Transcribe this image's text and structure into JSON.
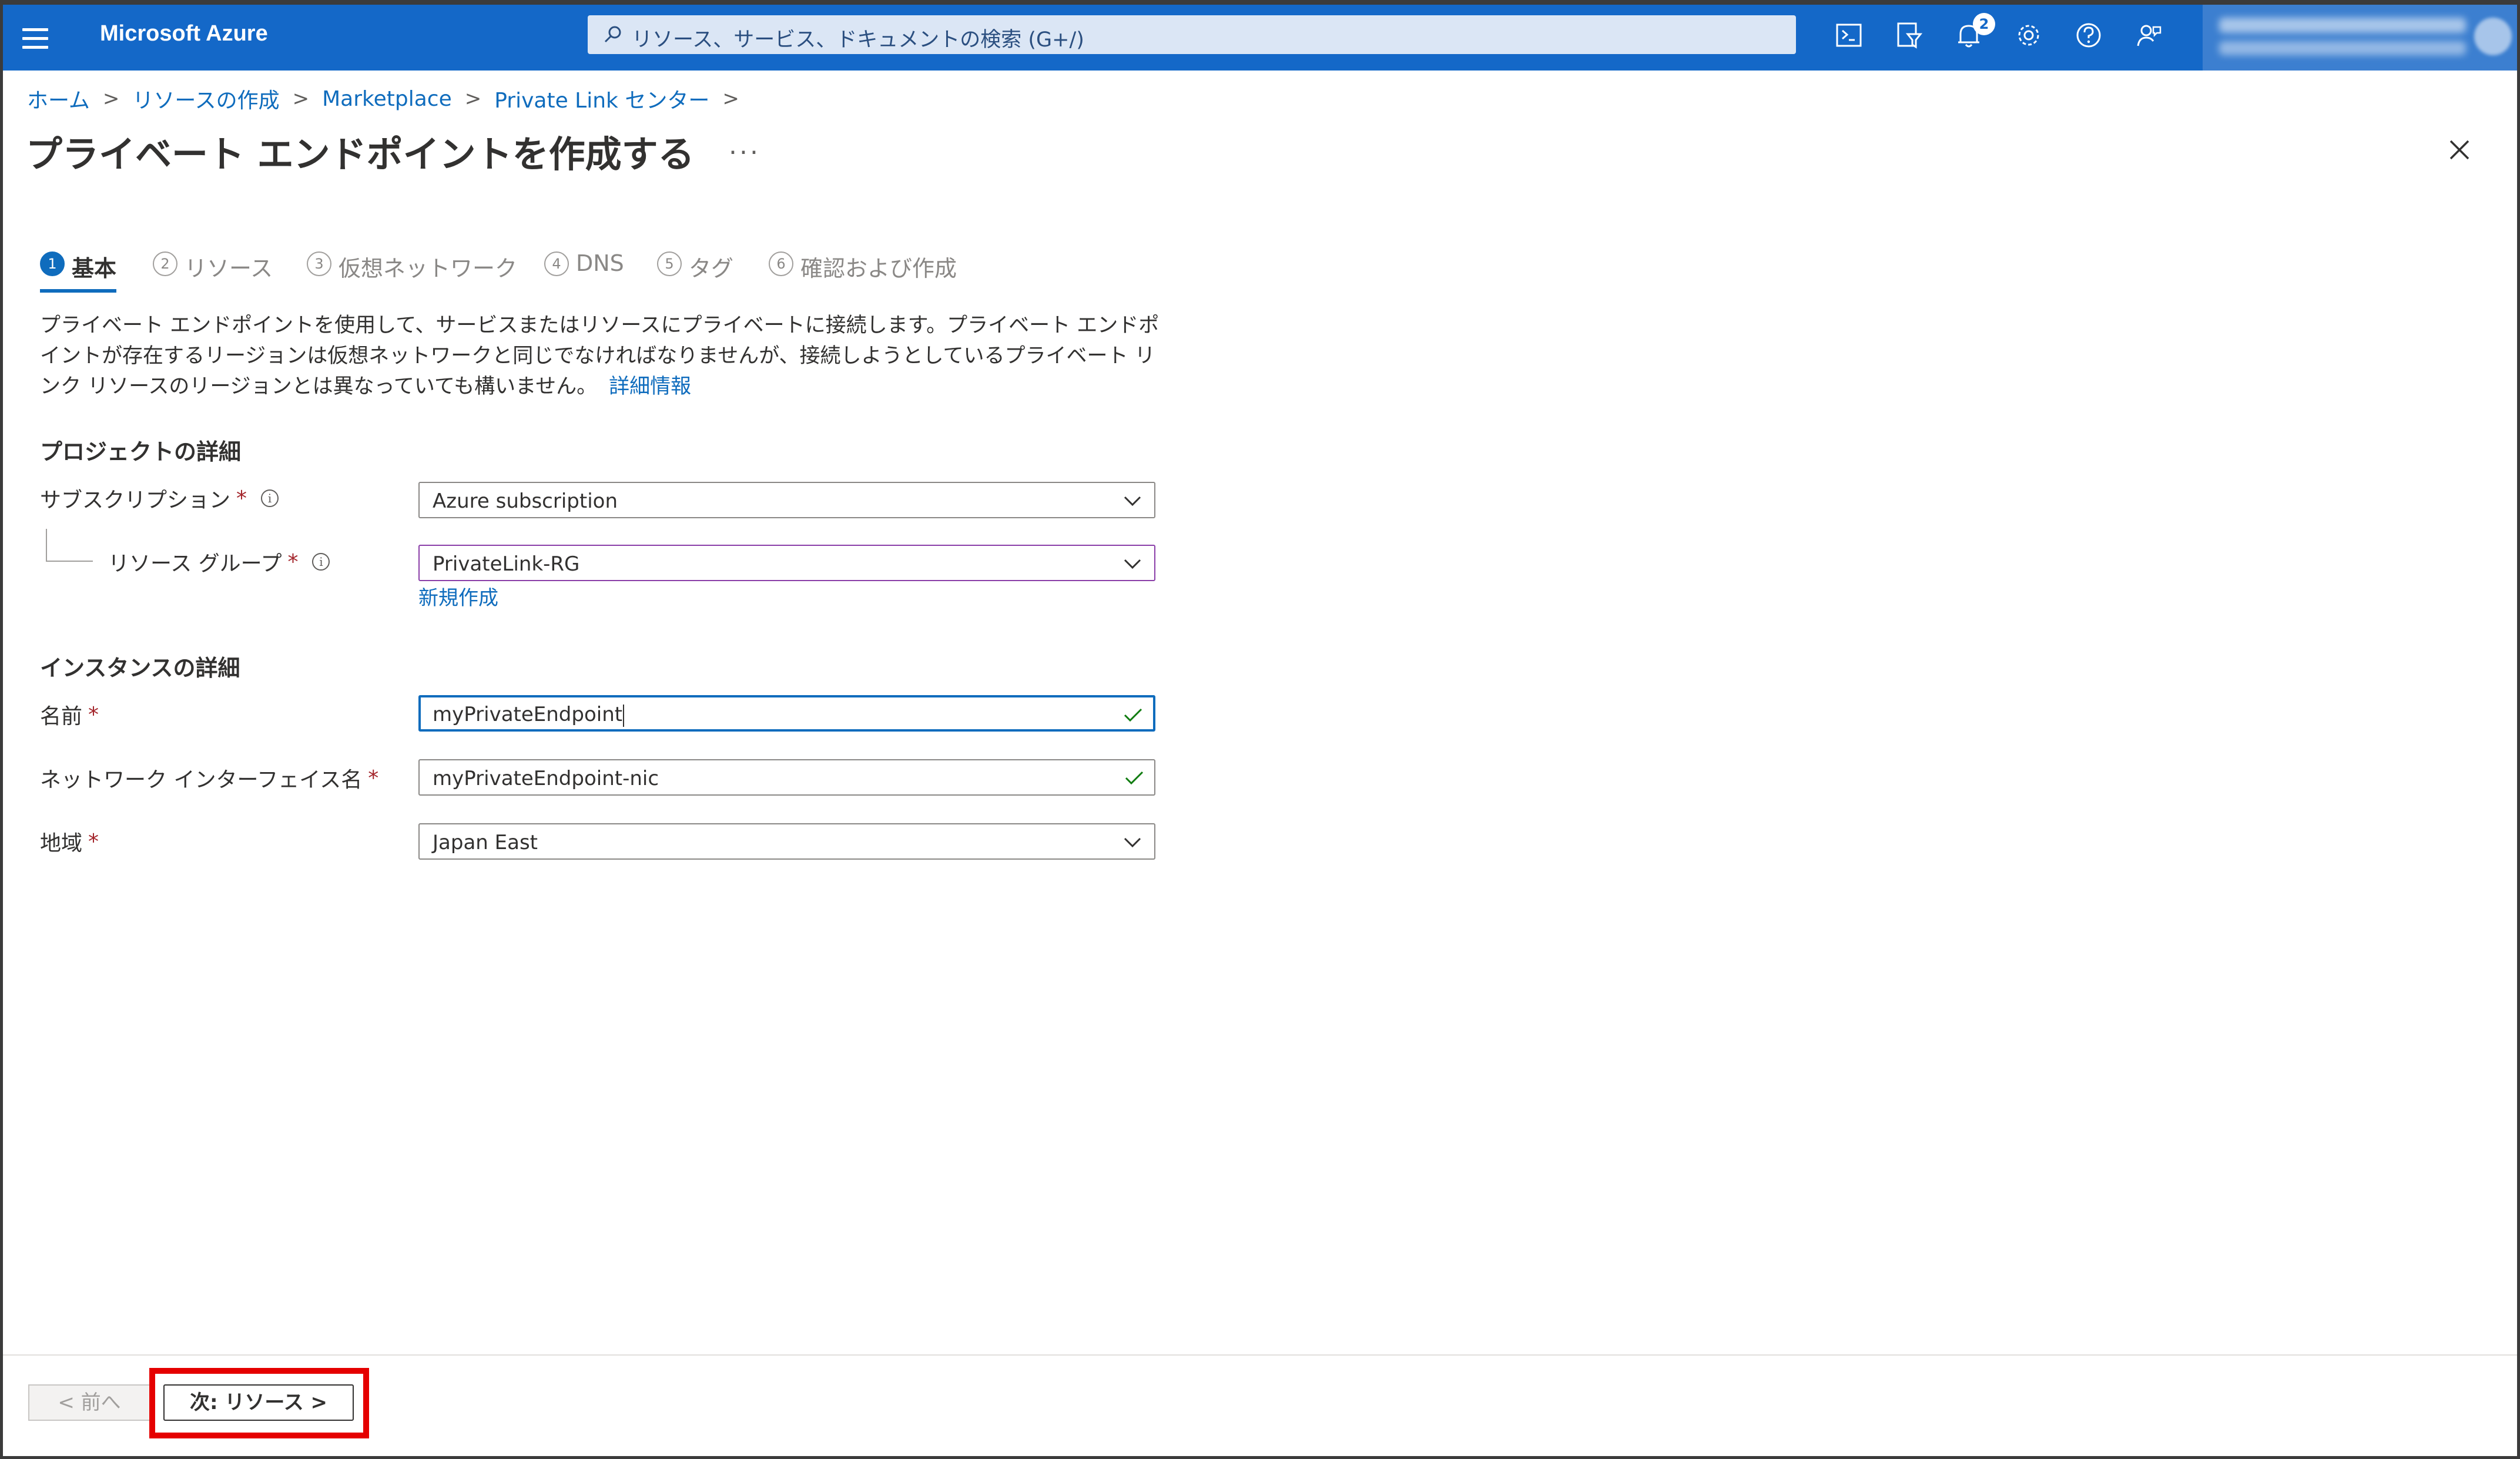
{
  "header": {
    "brand": "Microsoft Azure",
    "search_placeholder": "リソース、サービス、ドキュメントの検索 (G+/)",
    "notification_count": "2",
    "icons": [
      "menu-icon",
      "cloud-shell-icon",
      "directory-filter-icon",
      "notifications-icon",
      "settings-icon",
      "help-icon",
      "feedback-icon"
    ]
  },
  "breadcrumb": [
    "ホーム",
    "リソースの作成",
    "Marketplace",
    "Private Link センター"
  ],
  "page": {
    "title": "プライベート エンドポイントを作成する",
    "more": "..."
  },
  "tabs": [
    {
      "num": "1",
      "label": "基本",
      "active": true
    },
    {
      "num": "2",
      "label": "リソース",
      "active": false
    },
    {
      "num": "3",
      "label": "仮想ネットワーク",
      "active": false
    },
    {
      "num": "4",
      "label": "DNS",
      "active": false
    },
    {
      "num": "5",
      "label": "タグ",
      "active": false
    },
    {
      "num": "6",
      "label": "確認および作成",
      "active": false
    }
  ],
  "description": {
    "text": "プライベート エンドポイントを使用して、サービスまたはリソースにプライベートに接続します。プライベート エンドポイントが存在するリージョンは仮想ネットワークと同じでなければなりませんが、接続しようとしているプライベート リンク リソースのリージョンとは異なっていても構いません。",
    "link": "詳細情報"
  },
  "project": {
    "heading": "プロジェクトの詳細",
    "subscription_label": "サブスクリプション",
    "subscription_value": "Azure subscription",
    "resource_group_label": "リソース グループ",
    "resource_group_value": "PrivateLink-RG",
    "new_link": "新規作成"
  },
  "instance": {
    "heading": "インスタンスの詳細",
    "name_label": "名前",
    "name_value": "myPrivateEndpoint",
    "nic_label": "ネットワーク インターフェイス名",
    "nic_value": "myPrivateEndpoint-nic",
    "region_label": "地域",
    "region_value": "Japan East"
  },
  "required_mark": "*",
  "info_mark": "i",
  "footer": {
    "prev_label": "< 前へ",
    "next_label": "次: リソース >"
  },
  "colors": {
    "topbar": "#1468c8",
    "link": "#0f6cbd",
    "required": "#a4262c",
    "highlight": "#e50000",
    "valid_check": "#107c10"
  }
}
